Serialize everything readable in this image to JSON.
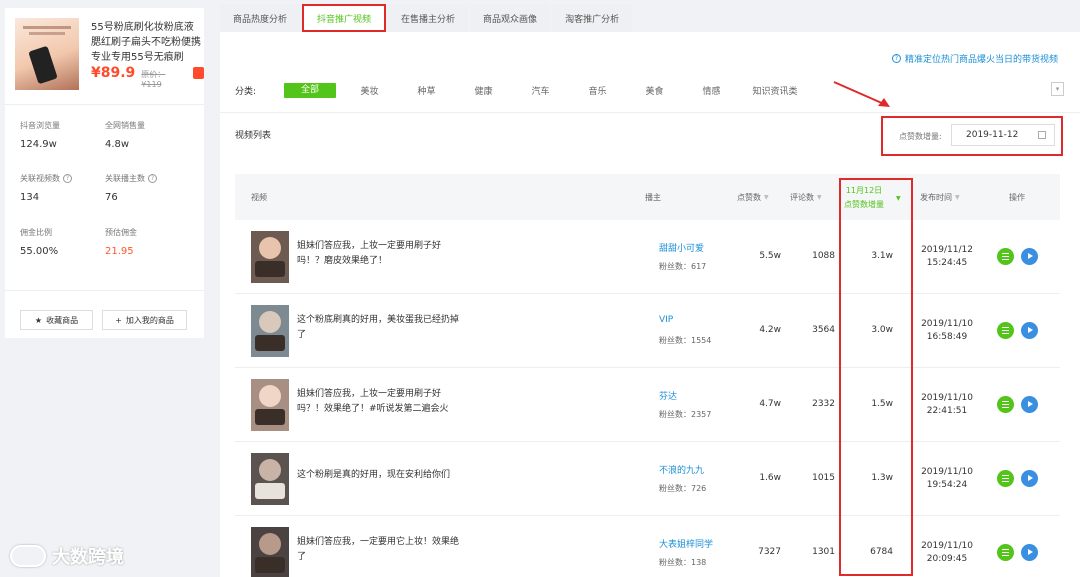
{
  "product": {
    "title": "55号粉底刷化妆粉底液腮红刷子扁头不吃粉便携专业专用55号无痕刷",
    "price": "¥89.9",
    "original_price": "原价：¥119"
  },
  "stats": [
    {
      "label": "抖音浏览量",
      "value": "124.9w",
      "has_help": false
    },
    {
      "label": "全网销售量",
      "value": "4.8w",
      "has_help": false
    },
    {
      "label": "关联视频数",
      "value": "134",
      "has_help": true
    },
    {
      "label": "关联播主数",
      "value": "76",
      "has_help": true
    },
    {
      "label": "佣金比例",
      "value": "55.00%",
      "has_help": false
    },
    {
      "label": "预估佣金",
      "value": "21.95",
      "has_help": false,
      "red": true
    }
  ],
  "left_buttons": {
    "favorite": "收藏商品",
    "add": "加入我的商品"
  },
  "tabs": [
    {
      "label": "商品热度分析",
      "active": false
    },
    {
      "label": "抖音推广视频",
      "active": true
    },
    {
      "label": "在售播主分析",
      "active": false
    },
    {
      "label": "商品观众画像",
      "active": false
    },
    {
      "label": "淘客推广分析",
      "active": false
    }
  ],
  "top_link": "精准定位热门商品爆火当日的带货视频",
  "categories": {
    "label": "分类:",
    "items": [
      "全部",
      "美妆",
      "种草",
      "健康",
      "汽车",
      "音乐",
      "美食",
      "情感",
      "知识资讯类"
    ]
  },
  "list_title": "视频列表",
  "date_filter": {
    "label": "点赞数增量:",
    "value": "2019-11-12"
  },
  "table": {
    "headers": {
      "video": "视频",
      "anchor": "播主",
      "likes": "点赞数",
      "comments": "评论数",
      "growth_line1": "11月12日",
      "growth_line2": "点赞数增量",
      "time": "发布时间",
      "action": "操作"
    },
    "rows": [
      {
        "desc": "姐妹们答应我，上妆一定要用刷子好吗！？磨皮效果绝了！",
        "anchor": "甜甜小可爱",
        "fans": "粉丝数：617",
        "likes": "5.5w",
        "comments": "1088",
        "growth": "3.1w",
        "date": "2019/11/12",
        "time": "15:24:45"
      },
      {
        "desc": "这个粉底刷真的好用，美妆蛋我已经扔掉了",
        "anchor": "VIP",
        "fans": "粉丝数：1554",
        "likes": "4.2w",
        "comments": "3564",
        "growth": "3.0w",
        "date": "2019/11/10",
        "time": "16:58:49"
      },
      {
        "desc": "姐妹们答应我，上妆一定要用刷子好吗？！效果绝了！#听说发第二遍会火",
        "anchor": "芬达",
        "fans": "粉丝数：2357",
        "likes": "4.7w",
        "comments": "2332",
        "growth": "1.5w",
        "date": "2019/11/10",
        "time": "22:41:51"
      },
      {
        "desc": "这个粉刷是真的好用，现在安利给你们",
        "anchor": "不浪的九九",
        "fans": "粉丝数：726",
        "likes": "1.6w",
        "comments": "1015",
        "growth": "1.3w",
        "date": "2019/11/10",
        "time": "19:54:24"
      },
      {
        "desc": "姐妹们答应我，一定要用它上妆！效果绝了",
        "anchor": "大表姐梓同学",
        "fans": "粉丝数：138",
        "likes": "7327",
        "comments": "1301",
        "growth": "6784",
        "date": "2019/11/10",
        "time": "20:09:45"
      }
    ]
  },
  "watermark": "大数跨境",
  "colors": {
    "accent": "#52c41a",
    "link": "#1b8fd6",
    "price": "#ff4b2b",
    "highlight": "#e02a2a"
  }
}
